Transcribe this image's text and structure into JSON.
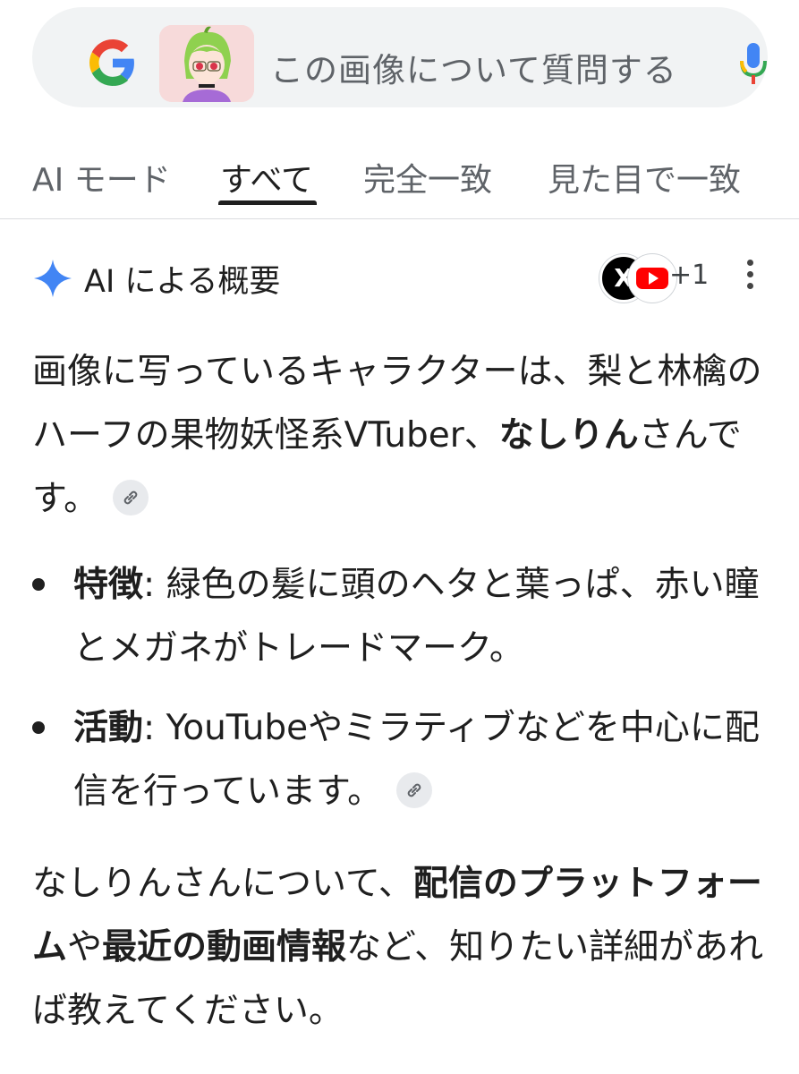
{
  "search": {
    "placeholder": "この画像について質問する"
  },
  "tabs": [
    {
      "label": "AI モード",
      "active": false
    },
    {
      "label": "すべて",
      "active": true
    },
    {
      "label": "完全一致",
      "active": false
    },
    {
      "label": "見た目で一致",
      "active": false
    }
  ],
  "ai_overview": {
    "title": "AI による概要",
    "sources_extra": "+1",
    "intro_1": "画像に写っているキャラクターは、梨と林檎のハーフの果物妖怪系VTuber、",
    "intro_bold": "なしりん",
    "intro_2": "さんです。",
    "bullets": [
      {
        "label": "特徴",
        "sep": ": ",
        "text": "緑色の髪に頭のヘタと葉っぱ、赤い瞳とメガネがトレードマーク。"
      },
      {
        "label": "活動",
        "sep": ": ",
        "text": "YouTubeやミラティブなどを中心に配信を行っています。"
      }
    ],
    "outro_1": "なしりんさんについて、",
    "outro_bold_1": "配信のプラットフォーム",
    "outro_2": "や",
    "outro_bold_2": "最近の動画情報",
    "outro_3": "など、知りたい詳細があれば教えてください。"
  },
  "colors": {
    "sparkle": "#4285f4",
    "youtube_red": "#ff0000",
    "text": "#1f1f1f",
    "muted": "#5f6368"
  },
  "icons": {
    "source_x": "X",
    "source_youtube": "youtube-icon"
  }
}
